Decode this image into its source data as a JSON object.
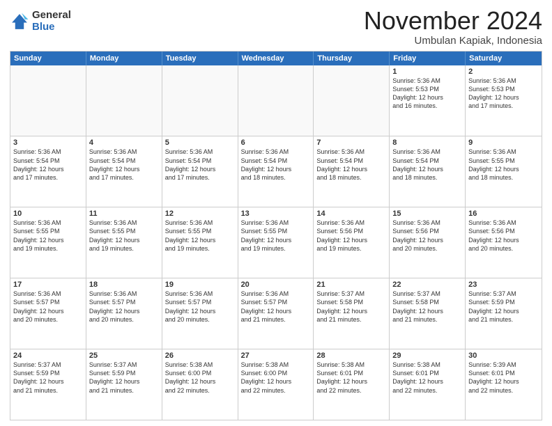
{
  "header": {
    "logo_general": "General",
    "logo_blue": "Blue",
    "month_title": "November 2024",
    "location": "Umbulan Kapiak, Indonesia"
  },
  "weekdays": [
    "Sunday",
    "Monday",
    "Tuesday",
    "Wednesday",
    "Thursday",
    "Friday",
    "Saturday"
  ],
  "weeks": [
    [
      {
        "day": "",
        "info": "",
        "empty": true
      },
      {
        "day": "",
        "info": "",
        "empty": true
      },
      {
        "day": "",
        "info": "",
        "empty": true
      },
      {
        "day": "",
        "info": "",
        "empty": true
      },
      {
        "day": "",
        "info": "",
        "empty": true
      },
      {
        "day": "1",
        "info": "Sunrise: 5:36 AM\nSunset: 5:53 PM\nDaylight: 12 hours\nand 16 minutes.",
        "empty": false
      },
      {
        "day": "2",
        "info": "Sunrise: 5:36 AM\nSunset: 5:53 PM\nDaylight: 12 hours\nand 17 minutes.",
        "empty": false
      }
    ],
    [
      {
        "day": "3",
        "info": "Sunrise: 5:36 AM\nSunset: 5:54 PM\nDaylight: 12 hours\nand 17 minutes.",
        "empty": false
      },
      {
        "day": "4",
        "info": "Sunrise: 5:36 AM\nSunset: 5:54 PM\nDaylight: 12 hours\nand 17 minutes.",
        "empty": false
      },
      {
        "day": "5",
        "info": "Sunrise: 5:36 AM\nSunset: 5:54 PM\nDaylight: 12 hours\nand 17 minutes.",
        "empty": false
      },
      {
        "day": "6",
        "info": "Sunrise: 5:36 AM\nSunset: 5:54 PM\nDaylight: 12 hours\nand 18 minutes.",
        "empty": false
      },
      {
        "day": "7",
        "info": "Sunrise: 5:36 AM\nSunset: 5:54 PM\nDaylight: 12 hours\nand 18 minutes.",
        "empty": false
      },
      {
        "day": "8",
        "info": "Sunrise: 5:36 AM\nSunset: 5:54 PM\nDaylight: 12 hours\nand 18 minutes.",
        "empty": false
      },
      {
        "day": "9",
        "info": "Sunrise: 5:36 AM\nSunset: 5:55 PM\nDaylight: 12 hours\nand 18 minutes.",
        "empty": false
      }
    ],
    [
      {
        "day": "10",
        "info": "Sunrise: 5:36 AM\nSunset: 5:55 PM\nDaylight: 12 hours\nand 19 minutes.",
        "empty": false
      },
      {
        "day": "11",
        "info": "Sunrise: 5:36 AM\nSunset: 5:55 PM\nDaylight: 12 hours\nand 19 minutes.",
        "empty": false
      },
      {
        "day": "12",
        "info": "Sunrise: 5:36 AM\nSunset: 5:55 PM\nDaylight: 12 hours\nand 19 minutes.",
        "empty": false
      },
      {
        "day": "13",
        "info": "Sunrise: 5:36 AM\nSunset: 5:55 PM\nDaylight: 12 hours\nand 19 minutes.",
        "empty": false
      },
      {
        "day": "14",
        "info": "Sunrise: 5:36 AM\nSunset: 5:56 PM\nDaylight: 12 hours\nand 19 minutes.",
        "empty": false
      },
      {
        "day": "15",
        "info": "Sunrise: 5:36 AM\nSunset: 5:56 PM\nDaylight: 12 hours\nand 20 minutes.",
        "empty": false
      },
      {
        "day": "16",
        "info": "Sunrise: 5:36 AM\nSunset: 5:56 PM\nDaylight: 12 hours\nand 20 minutes.",
        "empty": false
      }
    ],
    [
      {
        "day": "17",
        "info": "Sunrise: 5:36 AM\nSunset: 5:57 PM\nDaylight: 12 hours\nand 20 minutes.",
        "empty": false
      },
      {
        "day": "18",
        "info": "Sunrise: 5:36 AM\nSunset: 5:57 PM\nDaylight: 12 hours\nand 20 minutes.",
        "empty": false
      },
      {
        "day": "19",
        "info": "Sunrise: 5:36 AM\nSunset: 5:57 PM\nDaylight: 12 hours\nand 20 minutes.",
        "empty": false
      },
      {
        "day": "20",
        "info": "Sunrise: 5:36 AM\nSunset: 5:57 PM\nDaylight: 12 hours\nand 21 minutes.",
        "empty": false
      },
      {
        "day": "21",
        "info": "Sunrise: 5:37 AM\nSunset: 5:58 PM\nDaylight: 12 hours\nand 21 minutes.",
        "empty": false
      },
      {
        "day": "22",
        "info": "Sunrise: 5:37 AM\nSunset: 5:58 PM\nDaylight: 12 hours\nand 21 minutes.",
        "empty": false
      },
      {
        "day": "23",
        "info": "Sunrise: 5:37 AM\nSunset: 5:59 PM\nDaylight: 12 hours\nand 21 minutes.",
        "empty": false
      }
    ],
    [
      {
        "day": "24",
        "info": "Sunrise: 5:37 AM\nSunset: 5:59 PM\nDaylight: 12 hours\nand 21 minutes.",
        "empty": false
      },
      {
        "day": "25",
        "info": "Sunrise: 5:37 AM\nSunset: 5:59 PM\nDaylight: 12 hours\nand 21 minutes.",
        "empty": false
      },
      {
        "day": "26",
        "info": "Sunrise: 5:38 AM\nSunset: 6:00 PM\nDaylight: 12 hours\nand 22 minutes.",
        "empty": false
      },
      {
        "day": "27",
        "info": "Sunrise: 5:38 AM\nSunset: 6:00 PM\nDaylight: 12 hours\nand 22 minutes.",
        "empty": false
      },
      {
        "day": "28",
        "info": "Sunrise: 5:38 AM\nSunset: 6:01 PM\nDaylight: 12 hours\nand 22 minutes.",
        "empty": false
      },
      {
        "day": "29",
        "info": "Sunrise: 5:38 AM\nSunset: 6:01 PM\nDaylight: 12 hours\nand 22 minutes.",
        "empty": false
      },
      {
        "day": "30",
        "info": "Sunrise: 5:39 AM\nSunset: 6:01 PM\nDaylight: 12 hours\nand 22 minutes.",
        "empty": false
      }
    ]
  ]
}
